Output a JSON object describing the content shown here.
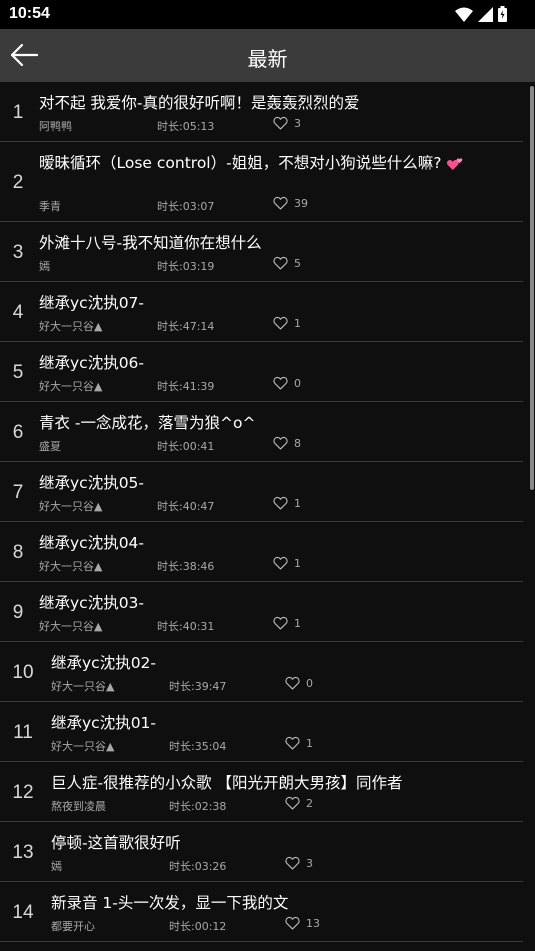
{
  "status": {
    "time": "10:54"
  },
  "header": {
    "title": "最新"
  },
  "duration_prefix": "时长:",
  "songs": [
    {
      "index": "1",
      "title": "对不起 我爱你-真的很好听啊！是轰轰烈烈的爱",
      "author": "阿鸭鸭",
      "duration": "05:13",
      "likes": "3"
    },
    {
      "index": "2",
      "title": "暧昧循环（Lose control）-姐姐，不想对小狗说些什么嘛?",
      "author": "季青",
      "duration": "03:07",
      "likes": "39"
    },
    {
      "index": "3",
      "title": "外滩十八号-我不知道你在想什么",
      "author": "嫣",
      "duration": "03:19",
      "likes": "5"
    },
    {
      "index": "4",
      "title": "继承yc沈执07-",
      "author": "好大一只谷▲",
      "duration": "47:14",
      "likes": "1"
    },
    {
      "index": "5",
      "title": "继承yc沈执06-",
      "author": "好大一只谷▲",
      "duration": "41:39",
      "likes": "0"
    },
    {
      "index": "6",
      "title": "青衣 -一念成花，落雪为狼^o^",
      "author": "盛夏",
      "duration": "00:41",
      "likes": "8"
    },
    {
      "index": "7",
      "title": "继承yc沈执05-",
      "author": "好大一只谷▲",
      "duration": "40:47",
      "likes": "1"
    },
    {
      "index": "8",
      "title": "继承yc沈执04-",
      "author": "好大一只谷▲",
      "duration": "38:46",
      "likes": "1"
    },
    {
      "index": "9",
      "title": "继承yc沈执03-",
      "author": "好大一只谷▲",
      "duration": "40:31",
      "likes": "1"
    },
    {
      "index": "10",
      "title": "继承yc沈执02-",
      "author": "好大一只谷▲",
      "duration": "39:47",
      "likes": "0"
    },
    {
      "index": "11",
      "title": "继承yc沈执01-",
      "author": "好大一只谷▲",
      "duration": "35:04",
      "likes": "1"
    },
    {
      "index": "12",
      "title": "巨人症-很推荐的小众歌 【阳光开朗大男孩】同作者",
      "author": "熬夜到凌晨",
      "duration": "02:38",
      "likes": "2"
    },
    {
      "index": "13",
      "title": "停顿-这首歌很好听",
      "author": "嫣",
      "duration": "03:26",
      "likes": "3"
    },
    {
      "index": "14",
      "title": "新录音 1-头一次发，显一下我的文",
      "author": "都要开心",
      "duration": "00:12",
      "likes": "13"
    }
  ],
  "colors": {
    "background": "#0f0f0f",
    "app_bar": "#3b3b3b",
    "emoji_heart": "#ff4d8d"
  },
  "icons": {
    "back": "back-arrow-icon",
    "like": "heart-outline-icon",
    "wifi": "wifi-icon",
    "signal": "signal-icon",
    "battery": "battery-icon",
    "emoji": "two-hearts-emoji-icon"
  }
}
